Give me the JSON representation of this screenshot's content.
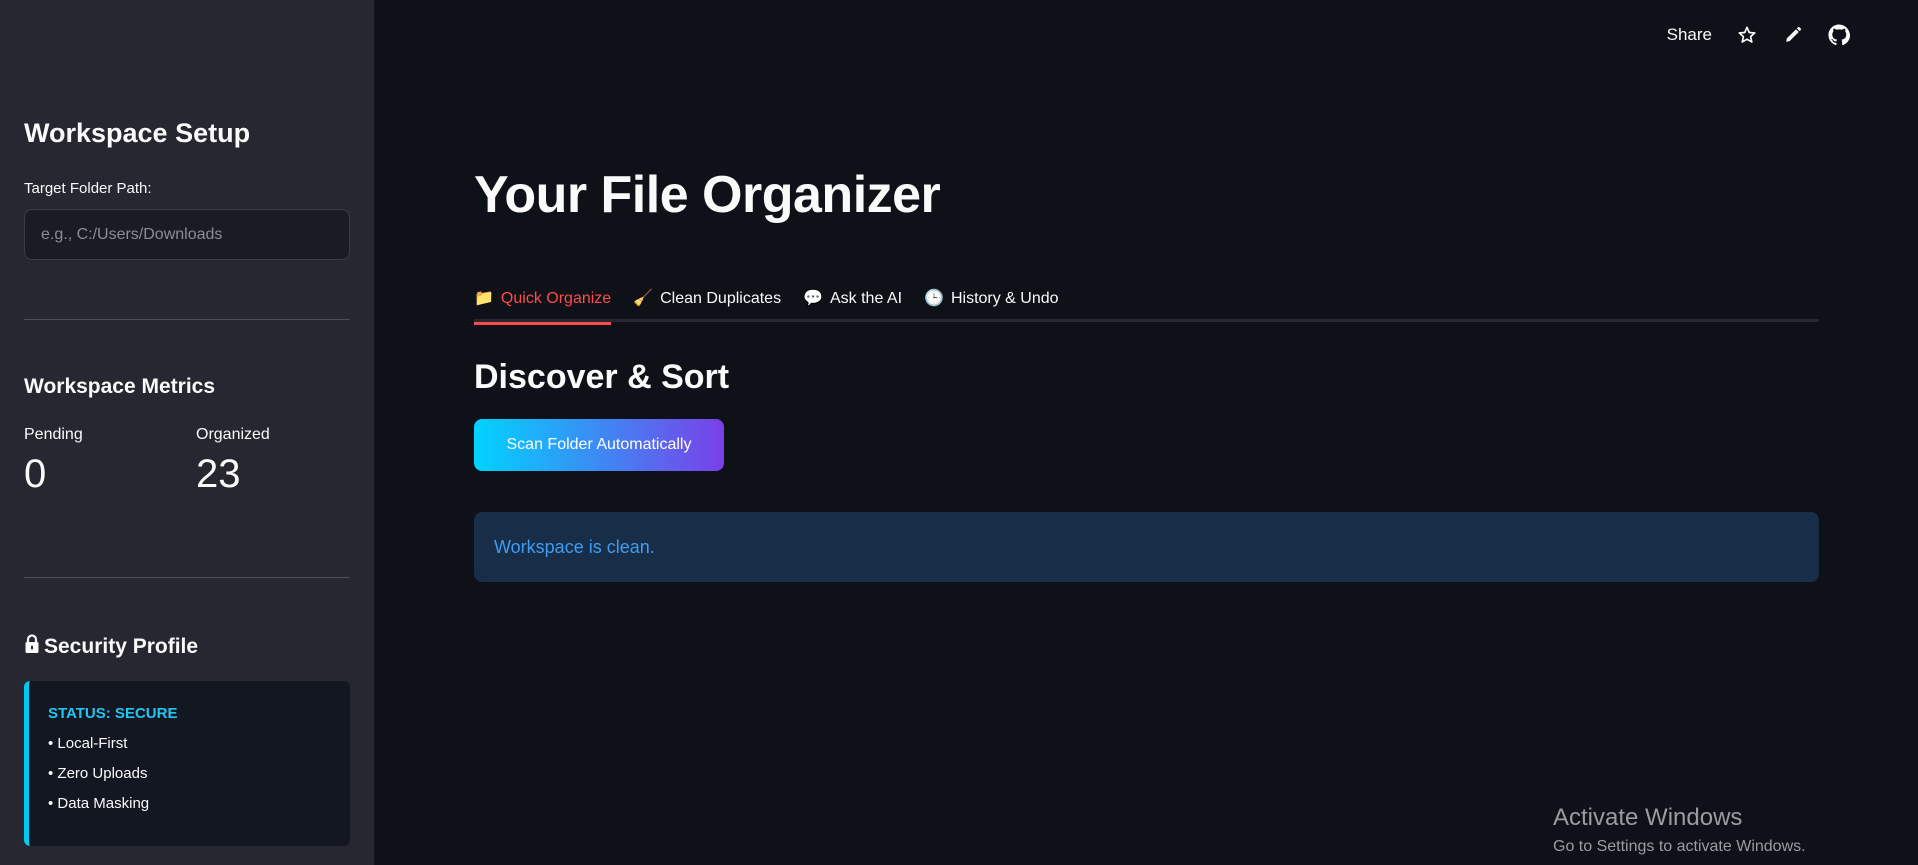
{
  "sidebar": {
    "title": "Workspace Setup",
    "folder_label": "Target Folder Path:",
    "folder_placeholder": "e.g., C:/Users/Downloads",
    "folder_value": "",
    "metrics_title": "Workspace Metrics",
    "metrics": [
      {
        "label": "Pending",
        "value": "0"
      },
      {
        "label": "Organized",
        "value": "23"
      }
    ],
    "security_title": "Security Profile",
    "security_status": "STATUS: SECURE",
    "security_items": [
      "• Local-First",
      "• Zero Uploads",
      "• Data Masking"
    ]
  },
  "toolbar": {
    "share_label": "Share",
    "icons": [
      "star-icon",
      "pencil-icon",
      "github-icon"
    ]
  },
  "main": {
    "title": "Your File Organizer",
    "tabs": [
      {
        "label": "Quick Organize",
        "icon": "folder-icon",
        "glyph": "📁",
        "active": true
      },
      {
        "label": "Clean Duplicates",
        "icon": "broom-icon",
        "glyph": "🧹",
        "active": false
      },
      {
        "label": "Ask the AI",
        "icon": "speech-bubble-icon",
        "glyph": "💬",
        "active": false
      },
      {
        "label": "History & Undo",
        "icon": "clock-icon",
        "glyph": "🕒",
        "active": false
      }
    ],
    "section_title": "Discover & Sort",
    "scan_button": "Scan Folder Automatically",
    "info_message": "Workspace is clean."
  },
  "watermark": {
    "title": "Activate Windows",
    "subtitle": "Go to Settings to activate Windows."
  },
  "colors": {
    "background": "#0e1117",
    "sidebar": "#262730",
    "accent_red": "#ff4b4b",
    "status_cyan": "#22c6f2",
    "info_bg": "#172d48",
    "info_text": "#3d9df3",
    "gradient_start": "#00d4ff",
    "gradient_end": "#7b3fe8"
  }
}
